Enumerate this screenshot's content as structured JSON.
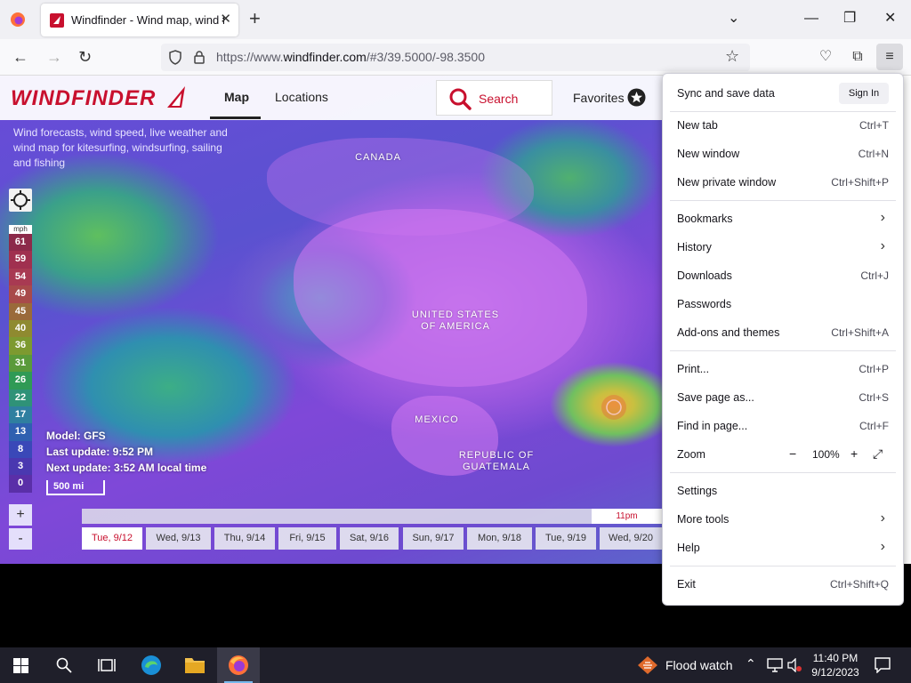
{
  "browser": {
    "tab_title": "Windfinder - Wind map, wind f",
    "url_prefix": "https://www.",
    "url_domain": "windfinder.com",
    "url_path": "/#3/39.5000/-98.3500"
  },
  "site": {
    "logo_text": "WINDFINDER",
    "nav": {
      "map": "Map",
      "locations": "Locations"
    },
    "search_label": "Search",
    "favorites_label": "Favorites",
    "tagline": "Wind forecasts, wind speed, live weather and wind map for kitesurfing, windsurfing, sailing and fishing"
  },
  "map": {
    "labels": {
      "canada": "CANADA",
      "usa": "UNITED STATES OF AMERICA",
      "mexico": "MEXICO",
      "guatemala": "REPUBLIC OF GUATEMALA"
    },
    "legend": {
      "unit": "mph",
      "values": [
        "61",
        "59",
        "54",
        "49",
        "45",
        "40",
        "36",
        "31",
        "26",
        "22",
        "17",
        "13",
        "8",
        "3",
        "0"
      ],
      "colors": [
        "#8c2a4a",
        "#a0304f",
        "#a83a52",
        "#a84a4a",
        "#9a6a3a",
        "#8f8a30",
        "#7d9a30",
        "#5a9a3a",
        "#2f9a55",
        "#2f9278",
        "#2f7fa0",
        "#2f60b0",
        "#3a48b8",
        "#4a38b0",
        "#5a2fa8"
      ]
    },
    "model_info": {
      "model": "Model: GFS",
      "last_update": "Last update: 9:52 PM",
      "next_update": "Next update: 3:52 AM local time"
    },
    "scale": "500 mi",
    "time_marker": "11pm",
    "days": [
      "Tue, 9/12",
      "Wed, 9/13",
      "Thu, 9/14",
      "Fri, 9/15",
      "Sat, 9/16",
      "Sun, 9/17",
      "Mon, 9/18",
      "Tue, 9/19",
      "Wed, 9/20"
    ]
  },
  "app_menu": {
    "sync_label": "Sync and save data",
    "sign_in": "Sign In",
    "new_tab": {
      "label": "New tab",
      "shortcut": "Ctrl+T"
    },
    "new_window": {
      "label": "New window",
      "shortcut": "Ctrl+N"
    },
    "new_private_window": {
      "label": "New private window",
      "shortcut": "Ctrl+Shift+P"
    },
    "bookmarks": "Bookmarks",
    "history": "History",
    "downloads": {
      "label": "Downloads",
      "shortcut": "Ctrl+J"
    },
    "passwords": "Passwords",
    "addons": {
      "label": "Add-ons and themes",
      "shortcut": "Ctrl+Shift+A"
    },
    "print": {
      "label": "Print...",
      "shortcut": "Ctrl+P"
    },
    "save_page": {
      "label": "Save page as...",
      "shortcut": "Ctrl+S"
    },
    "find": {
      "label": "Find in page...",
      "shortcut": "Ctrl+F"
    },
    "zoom": {
      "label": "Zoom",
      "value": "100%"
    },
    "settings": "Settings",
    "more_tools": "More tools",
    "help": "Help",
    "exit": {
      "label": "Exit",
      "shortcut": "Ctrl+Shift+Q"
    }
  },
  "taskbar": {
    "weather": "Flood watch",
    "time": "11:40 PM",
    "date": "9/12/2023"
  }
}
